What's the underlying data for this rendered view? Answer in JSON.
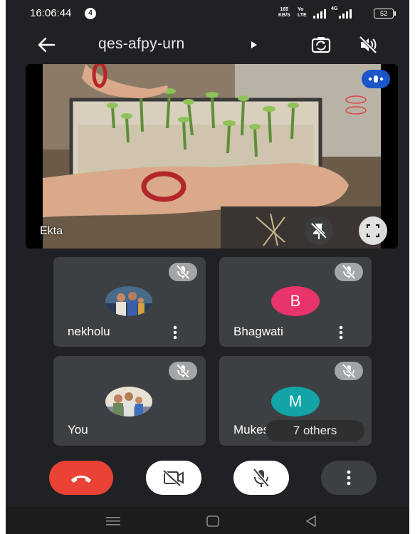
{
  "status_bar": {
    "time": "16:06:44",
    "notification_count": "4",
    "net_speed_value": "165",
    "net_speed_unit": "KB/S",
    "volte_top": "Yo",
    "volte_bottom": "LTE",
    "network_type": "4G",
    "battery": "52"
  },
  "header": {
    "meeting_code": "qes-afpy-urn",
    "icons": [
      "back-arrow-icon",
      "switch-camera-icon",
      "speaker-off-icon"
    ]
  },
  "main_video": {
    "participant_name": "Ekta",
    "icons": [
      "speaking-indicator-icon",
      "unpin-icon",
      "fullscreen-icon"
    ]
  },
  "participants": [
    {
      "name": "nekholu",
      "avatar": "photo",
      "muted": true
    },
    {
      "name": "Bhagwati",
      "avatar_letter": "B",
      "avatar_color": "#e8336b",
      "muted": true
    },
    {
      "name": "You",
      "avatar": "photo",
      "muted": true
    },
    {
      "name": "Mukesh",
      "avatar_letter": "M",
      "avatar_color": "#12a4a7",
      "muted": true
    }
  ],
  "others_chip": "7 others",
  "controls": {
    "end_call_color": "#ea4335",
    "icons": [
      "end-call-icon",
      "camera-off-icon",
      "mic-off-icon",
      "more-options-icon"
    ]
  },
  "colors": {
    "background": "#202124",
    "tile": "#3c4043",
    "accent_blue": "#1a56c8"
  }
}
